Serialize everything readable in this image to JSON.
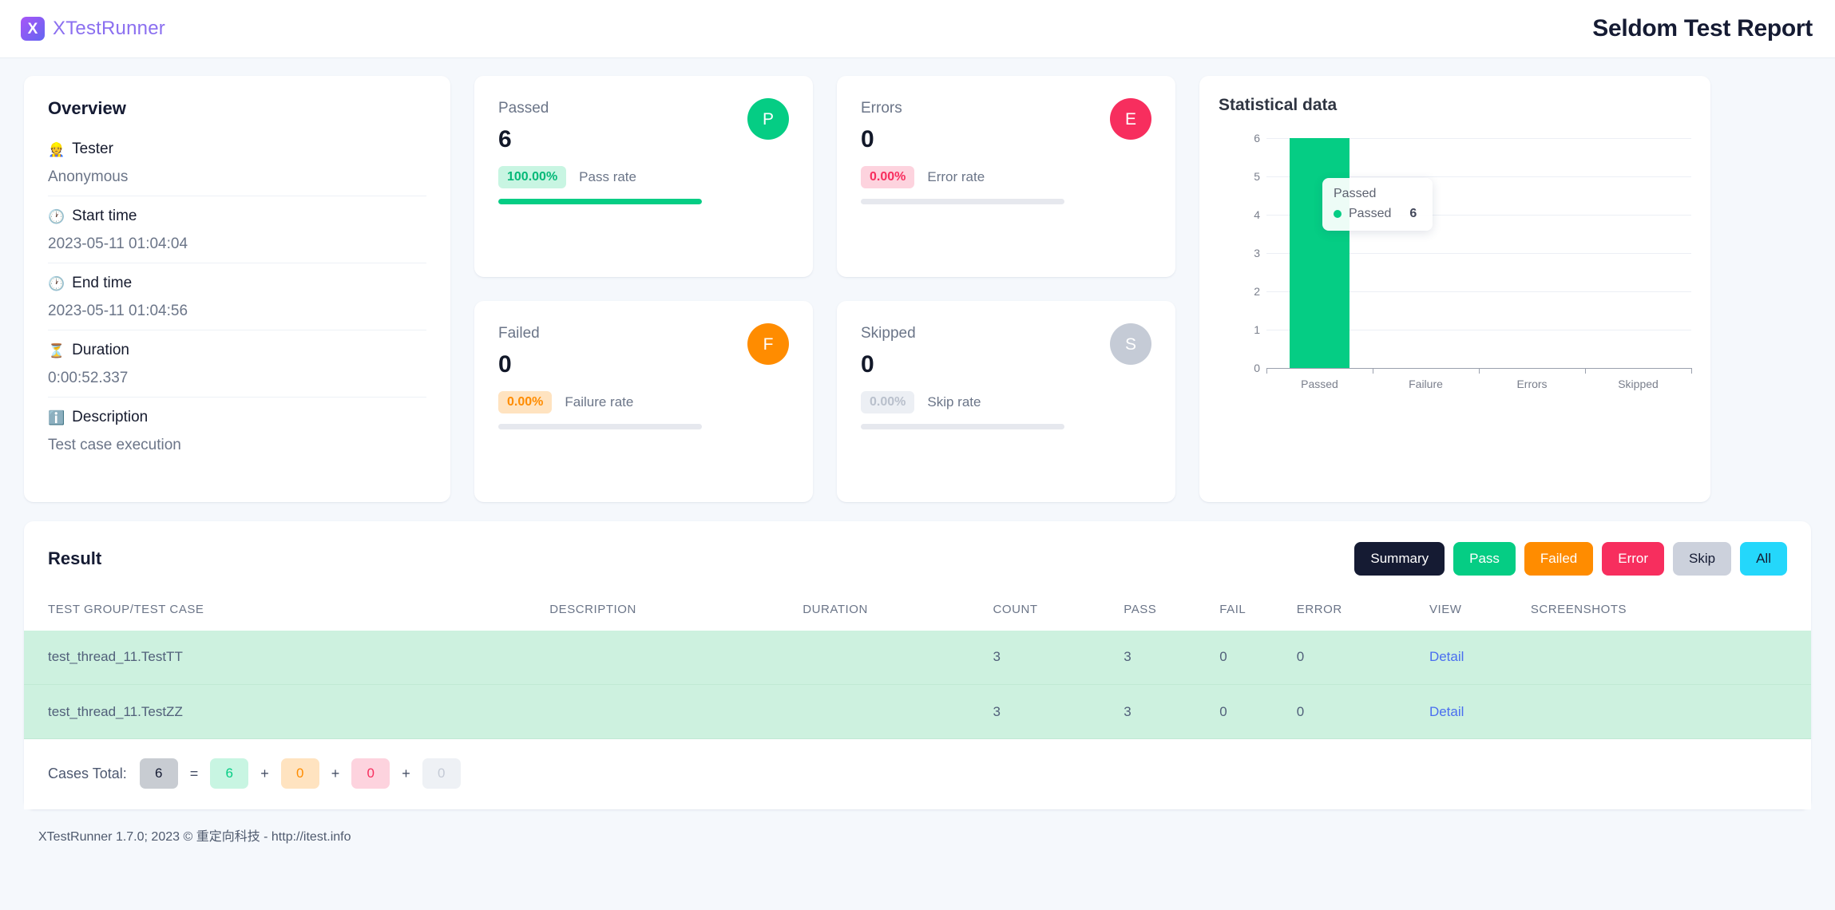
{
  "header": {
    "logo_letter": "X",
    "brand": "XTestRunner",
    "title": "Seldom Test Report"
  },
  "overview": {
    "title": "Overview",
    "rows": [
      {
        "icon": "👷",
        "icon_name": "tester-icon",
        "label": "Tester",
        "value": "Anonymous"
      },
      {
        "icon": "🕐",
        "icon_name": "clock-icon",
        "label": "Start time",
        "value": "2023-05-11 01:04:04"
      },
      {
        "icon": "🕐",
        "icon_name": "clock-icon",
        "label": "End time",
        "value": "2023-05-11 01:04:56"
      },
      {
        "icon": "⏳",
        "icon_name": "hourglass-icon",
        "label": "Duration",
        "value": "0:00:52.337"
      },
      {
        "icon": "ℹ️",
        "icon_name": "info-icon",
        "label": "Description",
        "value": "Test case execution"
      }
    ]
  },
  "stats": [
    {
      "name": "Passed",
      "count": "6",
      "badge_letter": "P",
      "rate": "100.00%",
      "rate_label": "Pass rate",
      "fill_pct": 100,
      "circle_color": "#05cd84",
      "badge_bg": "#c8f5e2",
      "badge_fg": "#05b978",
      "bar_color": "#05cd84"
    },
    {
      "name": "Errors",
      "count": "0",
      "badge_letter": "E",
      "rate": "0.00%",
      "rate_label": "Error rate",
      "fill_pct": 0,
      "circle_color": "#f72e5e",
      "badge_bg": "#fdd3de",
      "badge_fg": "#f72e5e",
      "bar_color": "#f72e5e"
    },
    {
      "name": "Failed",
      "count": "0",
      "badge_letter": "F",
      "rate": "0.00%",
      "rate_label": "Failure rate",
      "fill_pct": 0,
      "circle_color": "#ff8c00",
      "badge_bg": "#ffe3c0",
      "badge_fg": "#ff8c00",
      "bar_color": "#ff8c00"
    },
    {
      "name": "Skipped",
      "count": "0",
      "badge_letter": "S",
      "rate": "0.00%",
      "rate_label": "Skip rate",
      "fill_pct": 0,
      "circle_color": "#c5cbd6",
      "badge_bg": "#eceff4",
      "badge_fg": "#b9c0cc",
      "bar_color": "#c5cbd6"
    }
  ],
  "chart_card": {
    "title": "Statistical data"
  },
  "chart_data": {
    "type": "bar",
    "title": "Statistical data",
    "categories": [
      "Passed",
      "Failure",
      "Errors",
      "Skipped"
    ],
    "values": [
      6,
      0,
      0,
      0
    ],
    "colors": [
      "#05cd84",
      "#05cd84",
      "#05cd84",
      "#05cd84"
    ],
    "xlabel": "",
    "ylabel": "",
    "ylim": [
      0,
      6
    ],
    "yticks": [
      0,
      1,
      2,
      3,
      4,
      5,
      6
    ],
    "grid": true,
    "legend": false,
    "tooltip": {
      "title": "Passed",
      "series_name": "Passed",
      "value": "6",
      "dot_color": "#05cd84"
    }
  },
  "result": {
    "title": "Result",
    "filters": [
      {
        "label": "Summary",
        "bg": "#151b33",
        "fg": "#ffffff"
      },
      {
        "label": "Pass",
        "bg": "#05cd84",
        "fg": "#ffffff"
      },
      {
        "label": "Failed",
        "bg": "#ff8c00",
        "fg": "#ffffff"
      },
      {
        "label": "Error",
        "bg": "#f72e5e",
        "fg": "#ffffff"
      },
      {
        "label": "Skip",
        "bg": "#ccd1dc",
        "fg": "#151b33"
      },
      {
        "label": "All",
        "bg": "#24d7fb",
        "fg": "#151b33"
      }
    ],
    "columns": [
      "TEST GROUP/TEST CASE",
      "DESCRIPTION",
      "DURATION",
      "COUNT",
      "PASS",
      "FAIL",
      "ERROR",
      "VIEW",
      "SCREENSHOTS"
    ],
    "rows": [
      {
        "test_case": "test_thread_11.TestTT",
        "description": "",
        "duration": "",
        "count": "3",
        "pass": "3",
        "fail": "0",
        "error": "0",
        "view": "Detail",
        "screenshots": ""
      },
      {
        "test_case": "test_thread_11.TestZZ",
        "description": "",
        "duration": "",
        "count": "3",
        "pass": "3",
        "fail": "0",
        "error": "0",
        "view": "Detail",
        "screenshots": ""
      }
    ],
    "totals": {
      "label": "Cases Total:",
      "total": "6",
      "equals": "=",
      "plus": "+",
      "parts": [
        {
          "value": "6",
          "bg": "#c8f5e2",
          "fg": "#05cd84"
        },
        {
          "value": "0",
          "bg": "#ffe3c0",
          "fg": "#ff8c00"
        },
        {
          "value": "0",
          "bg": "#fdd3de",
          "fg": "#f72e5e"
        },
        {
          "value": "0",
          "bg": "#eef1f5",
          "fg": "#c4cad5"
        }
      ],
      "total_bg": "#c8ccd2",
      "total_fg": "#151b33"
    }
  },
  "footer": {
    "text": "XTestRunner 1.7.0; 2023 © 重定向科技 - http://itest.info"
  }
}
